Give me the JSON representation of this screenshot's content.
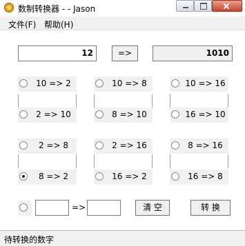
{
  "window": {
    "title": "数制转换器 - - Jason"
  },
  "menu": {
    "file": "文件(F)",
    "help": "帮助(H)"
  },
  "input": {
    "value": "12"
  },
  "convert_button": "=>",
  "result": {
    "value": "1010"
  },
  "options": [
    {
      "label": "10 => 2",
      "selected": false
    },
    {
      "label": "10 => 8",
      "selected": false
    },
    {
      "label": "10 => 16",
      "selected": false
    },
    {
      "label": "2 => 10",
      "selected": false
    },
    {
      "label": "8 => 10",
      "selected": false
    },
    {
      "label": "16 => 10",
      "selected": false
    },
    {
      "label": "2 => 8",
      "selected": false
    },
    {
      "label": "2 => 16",
      "selected": false
    },
    {
      "label": "8 => 16",
      "selected": false
    },
    {
      "label": "8 => 2",
      "selected": true
    },
    {
      "label": "16 => 2",
      "selected": false
    },
    {
      "label": "16 => 8",
      "selected": false
    }
  ],
  "custom": {
    "from_base": "",
    "arrow": "=>",
    "to_base": "",
    "selected": false
  },
  "buttons": {
    "clear": "清 空",
    "convert": "转 换"
  },
  "status": "待转换的数字"
}
